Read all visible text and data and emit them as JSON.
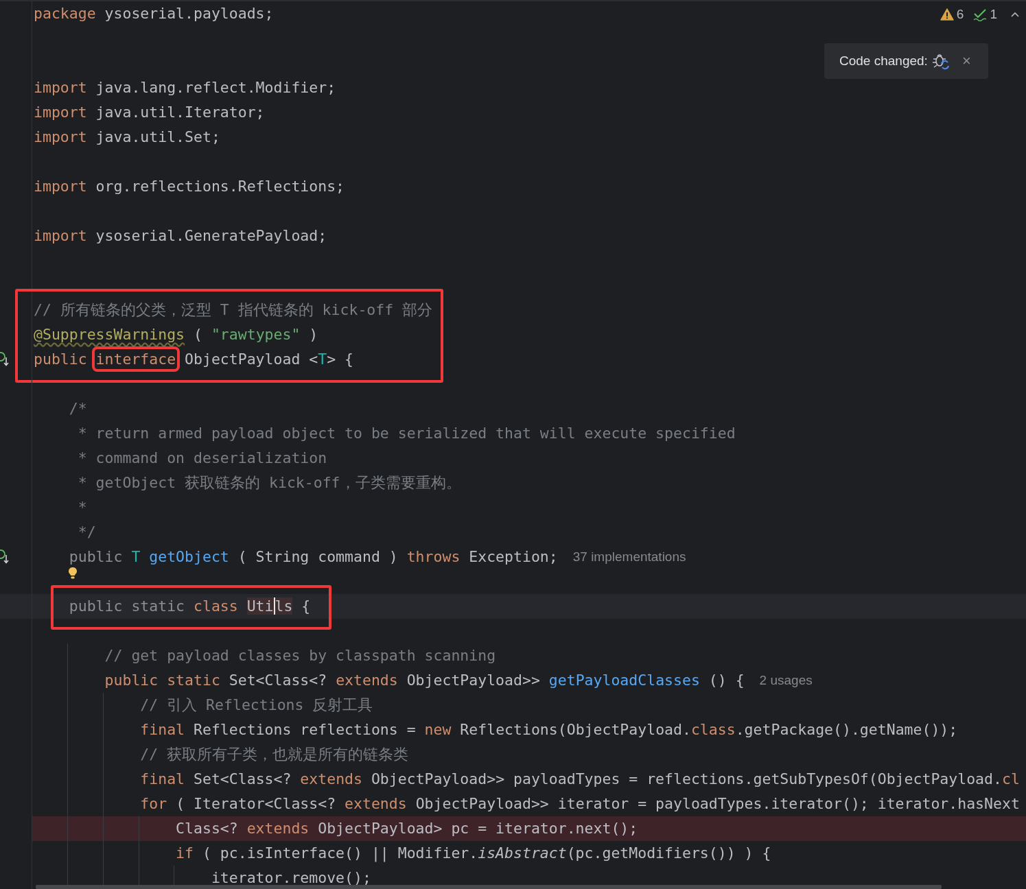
{
  "status": {
    "warnings": "6",
    "checks": "1"
  },
  "notification": {
    "text": "Code changed:",
    "close": "×"
  },
  "segments": [
    {
      "boxed": false,
      "lines": [
        {
          "kind": "code",
          "tokens": [
            {
              "text": "package",
              "kind": "kw"
            },
            {
              "text": " ysoserial.payloads;",
              "kind": "plain"
            }
          ]
        },
        {
          "kind": "blank"
        },
        {
          "kind": "blank"
        },
        {
          "kind": "code",
          "tokens": [
            {
              "text": "import",
              "kind": "kw"
            },
            {
              "text": " java.lang.reflect.Modifier;",
              "kind": "plain"
            }
          ]
        },
        {
          "kind": "code",
          "tokens": [
            {
              "text": "import",
              "kind": "kw"
            },
            {
              "text": " java.util.Iterator;",
              "kind": "plain"
            }
          ]
        },
        {
          "kind": "code",
          "tokens": [
            {
              "text": "import",
              "kind": "kw"
            },
            {
              "text": " java.util.Set;",
              "kind": "plain"
            }
          ]
        },
        {
          "kind": "blank"
        },
        {
          "kind": "code",
          "tokens": [
            {
              "text": "import",
              "kind": "kw"
            },
            {
              "text": " org.reflections.Reflections;",
              "kind": "plain"
            }
          ]
        },
        {
          "kind": "blank"
        },
        {
          "kind": "code",
          "tokens": [
            {
              "text": "import",
              "kind": "kw"
            },
            {
              "text": " ysoserial.GeneratePayload;",
              "kind": "plain"
            }
          ]
        },
        {
          "kind": "blank"
        },
        {
          "kind": "blank"
        }
      ]
    },
    {
      "boxed": true,
      "lines": [
        {
          "kind": "code",
          "tokens": [
            {
              "text": "// 所有链条的父类，泛型 T 指代链条的 kick-off 部分",
              "kind": "comment"
            }
          ]
        },
        {
          "kind": "code",
          "tokens": [
            {
              "text": "@SuppressWarnings",
              "kind": "anno"
            },
            {
              "text": " ( ",
              "kind": "plain"
            },
            {
              "text": "\"rawtypes\"",
              "kind": "string"
            },
            {
              "text": " )",
              "kind": "plain"
            }
          ]
        },
        {
          "kind": "code",
          "implemented": true,
          "tokens": [
            {
              "text": "public ",
              "kind": "kw"
            },
            {
              "text": "interface",
              "kind": "kw",
              "boxed": true
            },
            {
              "text": " ObjectPayload <",
              "kind": "plain"
            },
            {
              "text": "T",
              "kind": "tparam"
            },
            {
              "text": "> {",
              "kind": "plain"
            }
          ]
        }
      ]
    },
    {
      "boxed": false,
      "lines": [
        {
          "kind": "blank"
        },
        {
          "kind": "code",
          "tokens": [
            {
              "text": "    /*",
              "kind": "comment"
            }
          ]
        },
        {
          "kind": "code",
          "tokens": [
            {
              "text": "     * return armed payload object to be serialized that will execute specified",
              "kind": "comment"
            }
          ]
        },
        {
          "kind": "code",
          "tokens": [
            {
              "text": "     * command on deserialization",
              "kind": "comment"
            }
          ]
        },
        {
          "kind": "code",
          "tokens": [
            {
              "text": "     * getObject 获取链条的 kick-off，子类需要重构。",
              "kind": "comment"
            }
          ]
        },
        {
          "kind": "code",
          "tokens": [
            {
              "text": "     *",
              "kind": "comment"
            }
          ]
        },
        {
          "kind": "code",
          "tokens": [
            {
              "text": "     */",
              "kind": "comment"
            }
          ]
        },
        {
          "kind": "code",
          "implemented": true,
          "tokens": [
            {
              "text": "    public ",
              "kind": "dim"
            },
            {
              "text": "T ",
              "kind": "tparam"
            },
            {
              "text": "getObject",
              "kind": "method"
            },
            {
              "text": " ( String command ) ",
              "kind": "plain"
            },
            {
              "text": "throws",
              "kind": "kw"
            },
            {
              "text": " Exception;",
              "kind": "plain"
            },
            {
              "text": "37 implementations",
              "kind": "hint"
            }
          ]
        },
        {
          "kind": "blank",
          "bulb": true
        }
      ]
    },
    {
      "boxed": true,
      "lines": [
        {
          "kind": "code",
          "current": true,
          "tokens": [
            {
              "text": "    public static ",
              "kind": "dim"
            },
            {
              "text": "class ",
              "kind": "kw"
            },
            {
              "parts": [
                "Uti",
                "ls"
              ],
              "kind": "plain",
              "occurrence": true,
              "caret": true
            },
            {
              "text": " {",
              "kind": "plain"
            }
          ]
        }
      ]
    },
    {
      "boxed": false,
      "lines": [
        {
          "kind": "blank"
        },
        {
          "kind": "code",
          "tokens": [
            {
              "text": "        // get payload classes by classpath scanning",
              "kind": "comment"
            }
          ]
        },
        {
          "kind": "code",
          "tokens": [
            {
              "text": "        public static",
              "kind": "kw"
            },
            {
              "text": " Set<Class<? ",
              "kind": "plain"
            },
            {
              "text": "extends",
              "kind": "kw"
            },
            {
              "text": " ObjectPayload>> ",
              "kind": "plain"
            },
            {
              "text": "getPayloadClasses",
              "kind": "method"
            },
            {
              "text": " () {",
              "kind": "plain"
            },
            {
              "text": "2 usages",
              "kind": "hint"
            }
          ]
        },
        {
          "kind": "code",
          "tokens": [
            {
              "text": "            // 引入 Reflections 反射工具",
              "kind": "comment"
            }
          ]
        },
        {
          "kind": "code",
          "tokens": [
            {
              "text": "            final",
              "kind": "kw"
            },
            {
              "text": " Reflections reflections = ",
              "kind": "plain"
            },
            {
              "text": "new",
              "kind": "kw"
            },
            {
              "text": " Reflections(ObjectPayload.",
              "kind": "plain"
            },
            {
              "text": "class",
              "kind": "kw"
            },
            {
              "text": ".getPackage().getName());",
              "kind": "plain"
            }
          ]
        },
        {
          "kind": "code",
          "tokens": [
            {
              "text": "            // 获取所有子类，也就是所有的链条类",
              "kind": "comment"
            }
          ]
        },
        {
          "kind": "code",
          "tokens": [
            {
              "text": "            final",
              "kind": "kw"
            },
            {
              "text": " Set<Class<? ",
              "kind": "plain"
            },
            {
              "text": "extends",
              "kind": "kw"
            },
            {
              "text": " ObjectPayload>> payloadTypes = reflections.getSubTypesOf(ObjectPayload.",
              "kind": "plain"
            },
            {
              "text": "cl",
              "kind": "kw"
            }
          ]
        },
        {
          "kind": "code",
          "tokens": [
            {
              "text": "            for",
              "kind": "kw"
            },
            {
              "text": " ( Iterator<Class<? ",
              "kind": "plain"
            },
            {
              "text": "extends",
              "kind": "kw"
            },
            {
              "text": " ObjectPayload>> iterator = payloadTypes.iterator(); iterator.hasNext",
              "kind": "plain"
            }
          ]
        },
        {
          "kind": "code",
          "error": true,
          "tokens": [
            {
              "text": "                Class<? ",
              "kind": "plain"
            },
            {
              "text": "extends",
              "kind": "kw"
            },
            {
              "text": " ObjectPayload> pc = iterator.next();",
              "kind": "plain"
            }
          ]
        },
        {
          "kind": "code",
          "tokens": [
            {
              "text": "                if",
              "kind": "kw"
            },
            {
              "text": " ( pc.isInterface() || Modifier.",
              "kind": "plain"
            },
            {
              "text": "isAbstract",
              "kind": "italic"
            },
            {
              "text": "(pc.getModifiers()) ) {",
              "kind": "plain"
            }
          ]
        },
        {
          "kind": "code",
          "tokens": [
            {
              "text": "                    iterator.remove();",
              "kind": "plain"
            }
          ]
        }
      ]
    }
  ]
}
